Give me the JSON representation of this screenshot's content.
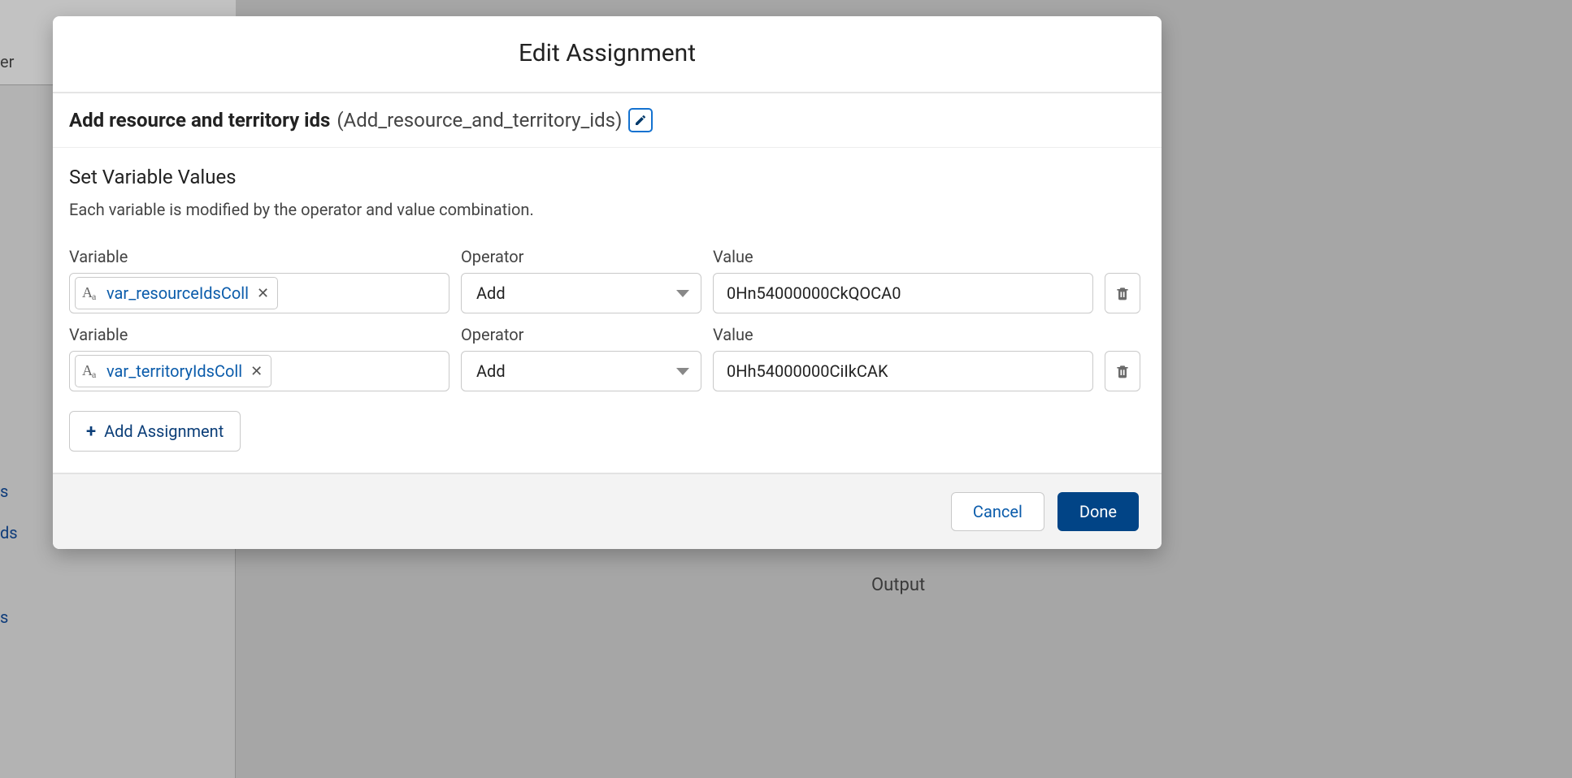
{
  "modal": {
    "title": "Edit Assignment",
    "elementLabel": "Add resource and territory ids",
    "elementApiName": "(Add_resource_and_territory_ids)",
    "sectionTitle": "Set Variable Values",
    "sectionHelp": "Each variable is modified by the operator and value combination.",
    "columns": {
      "variable": "Variable",
      "operator": "Operator",
      "value": "Value"
    },
    "rows": [
      {
        "variable": "var_resourceIdsColl",
        "operator": "Add",
        "value": "0Hn54000000CkQOCA0"
      },
      {
        "variable": "var_territoryIdsColl",
        "operator": "Add",
        "value": "0Hh54000000CiIkCAK"
      }
    ],
    "addAssignmentLabel": "Add Assignment",
    "footer": {
      "cancel": "Cancel",
      "done": "Done"
    }
  },
  "background": {
    "frag1": "er",
    "frag2": "s",
    "frag3": "ds",
    "frag4": "s",
    "outputLabel": "Output"
  }
}
